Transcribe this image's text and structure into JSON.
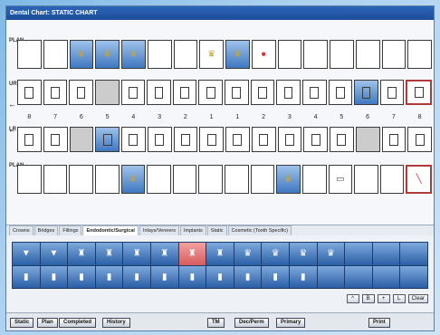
{
  "window": {
    "title": "Dental Chart: STATIC CHART"
  },
  "side_labels": {
    "plan_top": "PLAN",
    "ur": "UR",
    "lr": "LR",
    "plan_bottom": "PLAN"
  },
  "tooth_numbers": [
    "8",
    "7",
    "6",
    "5",
    "4",
    "3",
    "2",
    "1",
    "1",
    "2",
    "3",
    "4",
    "5",
    "6",
    "7",
    "8"
  ],
  "tabs": [
    {
      "label": "Crowns",
      "active": false
    },
    {
      "label": "Bridges",
      "active": false
    },
    {
      "label": "Fillings",
      "active": false
    },
    {
      "label": "Endodontic/Surgical",
      "active": true
    },
    {
      "label": "Inlays/Veneers",
      "active": false
    },
    {
      "label": "Implants",
      "active": false
    },
    {
      "label": "Static",
      "active": false
    },
    {
      "label": "Cosmetic (Tooth Specific)",
      "active": false
    }
  ],
  "palette_top_glyphs": [
    "▼",
    "▼",
    "♜",
    "♜",
    "♜",
    "♜",
    "♜",
    "♜",
    "♛",
    "♛",
    "♛",
    "♛",
    "",
    "",
    ""
  ],
  "palette_bottom_glyphs": [
    "▮",
    "▮",
    "▮",
    "▮",
    "▮",
    "▮",
    "▮",
    "▮",
    "▮",
    "▮",
    "▮",
    "",
    "",
    "",
    ""
  ],
  "small_controls": {
    "up": "^",
    "b": "B",
    "plus": "+",
    "l": "L",
    "clear": "Clear"
  },
  "footer": {
    "static": "Static",
    "plan": "Plan",
    "completed": "Completed",
    "history": "History",
    "tm": "TM",
    "dec_perm": "Dec/Perm",
    "primary": "Primary",
    "print": "Print"
  },
  "colors": {
    "title_bar": "#1b4d9a",
    "selected_tooth": "#3f78c0",
    "palette_bg": "#1c3d6c"
  }
}
